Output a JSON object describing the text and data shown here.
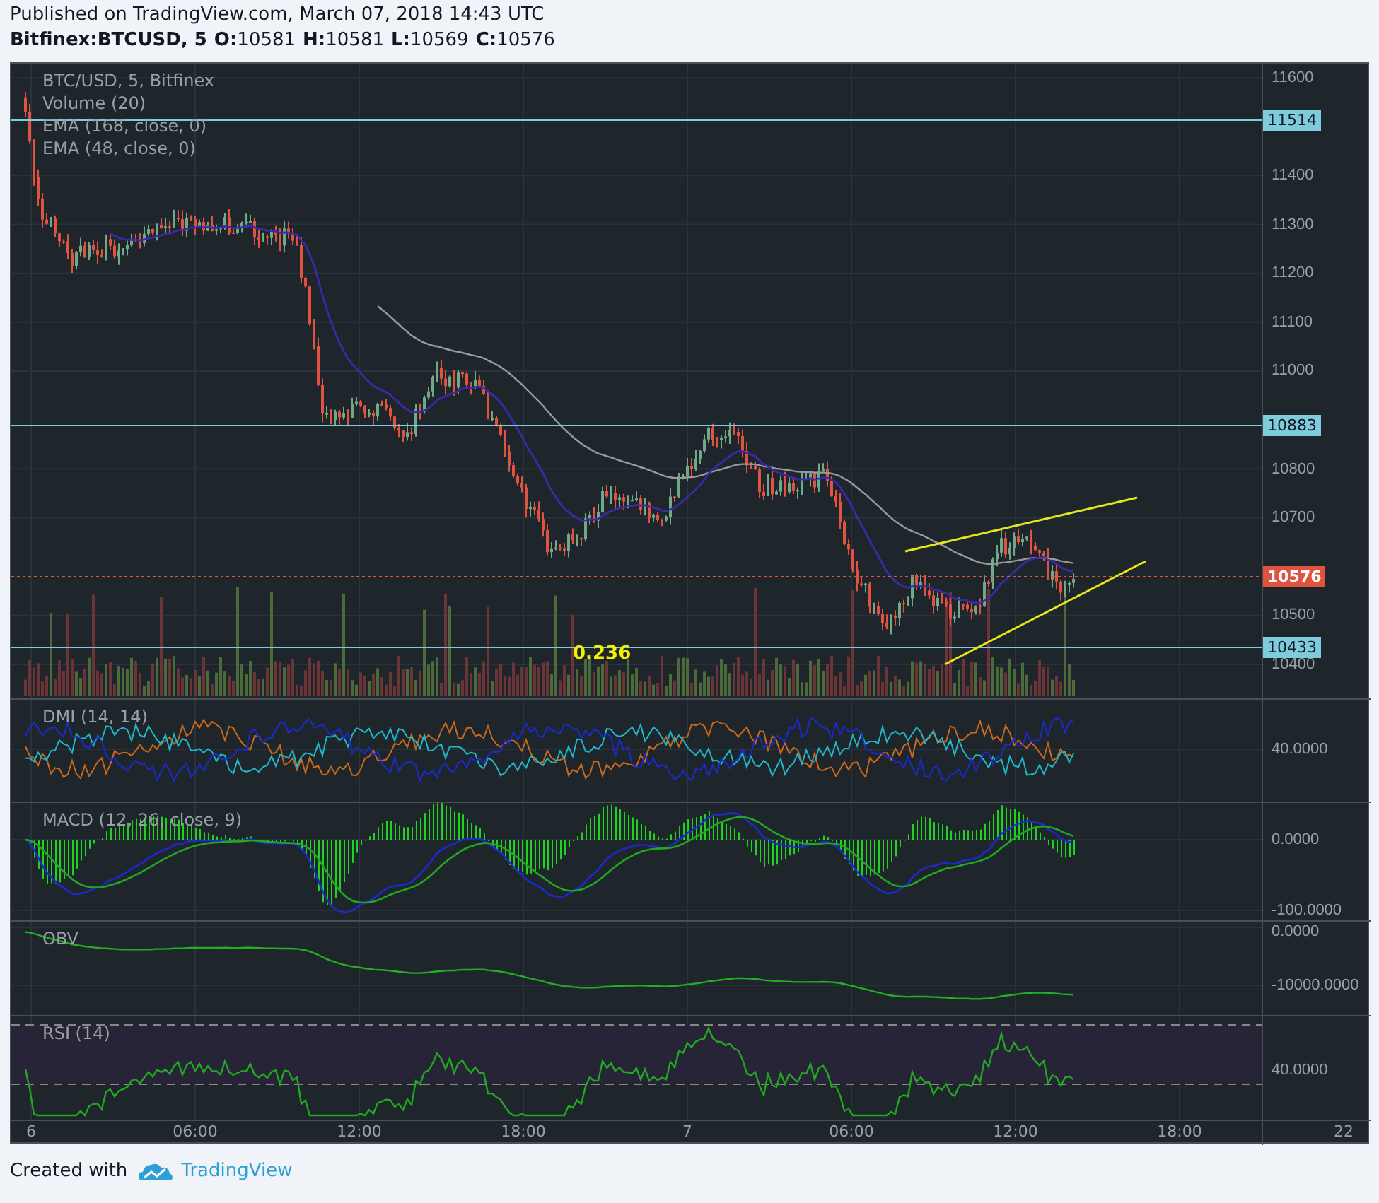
{
  "header": {
    "published": "Published on TradingView.com, March 07, 2018 14:43 UTC",
    "symbol": "Bitfinex:BTCUSD, 5",
    "ohlc": [
      {
        "label": "O:",
        "value": "10581"
      },
      {
        "label": "H:",
        "value": "10581"
      },
      {
        "label": "L:",
        "value": "10569"
      },
      {
        "label": "C:",
        "value": "10576"
      }
    ]
  },
  "main_pane": {
    "legend": [
      "BTC/USD, 5, Bitfinex",
      "Volume (20)",
      "EMA (168, close, 0)",
      "EMA (48, close, 0)"
    ],
    "annotation": "0.236",
    "price_ticks": [
      "11600",
      "11400",
      "11300",
      "11200",
      "11100",
      "11000",
      "10800",
      "10700",
      "10500",
      "10400"
    ],
    "levels": [
      {
        "value": "11514",
        "kind": "line"
      },
      {
        "value": "10883",
        "kind": "line"
      },
      {
        "value": "10576",
        "kind": "last"
      },
      {
        "value": "10433",
        "kind": "line"
      }
    ]
  },
  "panes": [
    {
      "kind": "dmi",
      "legend": "DMI (14, 14)",
      "ticks": [
        "40.0000"
      ]
    },
    {
      "kind": "macd",
      "legend": "MACD (12, 26, close, 9)",
      "ticks": [
        "0.0000",
        "-100.0000"
      ]
    },
    {
      "kind": "obv",
      "legend": "OBV",
      "ticks": [
        "0.0000",
        "-10000.0000"
      ]
    },
    {
      "kind": "rsi",
      "legend": "RSI (14)",
      "ticks": [
        "40.0000"
      ]
    }
  ],
  "time_axis": [
    "6",
    "06:00",
    "12:00",
    "18:00",
    "7",
    "06:00",
    "12:00",
    "18:00",
    "22"
  ],
  "footer": {
    "text": "Created with",
    "brand": "TradingView"
  }
}
